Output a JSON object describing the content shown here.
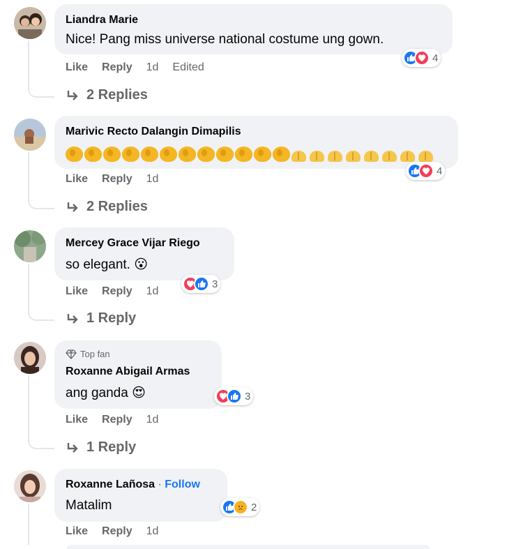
{
  "comments": [
    {
      "author": "Liandra Marie",
      "text": "Nice! Pang miss universe national costume ung gown.",
      "actions": {
        "like": "Like",
        "reply": "Reply",
        "time": "1d",
        "edited": "Edited"
      },
      "reactions": {
        "types": [
          "like",
          "love"
        ],
        "count": "4"
      },
      "replies_label": "2 Replies"
    },
    {
      "author": "Marivic Recto Dalangin Dimapilis",
      "text_emojis": {
        "clapping_hands": 12,
        "folded_hands": 8
      },
      "actions": {
        "like": "Like",
        "reply": "Reply",
        "time": "1d"
      },
      "reactions": {
        "types": [
          "like",
          "love"
        ],
        "count": "4"
      },
      "replies_label": "2 Replies"
    },
    {
      "author": "Mercey Grace Vijar Riego",
      "text": "so elegant. 😮",
      "actions": {
        "like": "Like",
        "reply": "Reply",
        "time": "1d"
      },
      "reactions": {
        "types": [
          "love",
          "like"
        ],
        "count": "3"
      },
      "replies_label": "1 Reply"
    },
    {
      "badge": "Top fan",
      "author": "Roxanne Abigail Armas",
      "text": "ang ganda 😍",
      "actions": {
        "like": "Like",
        "reply": "Reply",
        "time": "1d"
      },
      "reactions": {
        "types": [
          "love",
          "like"
        ],
        "count": "3"
      },
      "replies_label": "1 Reply"
    },
    {
      "author": "Roxanne Lañosa",
      "separator": " · ",
      "follow": "Follow",
      "text": "Matalim",
      "actions": {
        "like": "Like",
        "reply": "Reply",
        "time": "1d"
      },
      "reactions": {
        "types": [
          "like",
          "sad"
        ],
        "count": "2"
      }
    }
  ],
  "colors": {
    "bubble": "#f0f2f5",
    "like": "#1877f2",
    "love": "#f33e58",
    "sad": "#f7b125",
    "muted": "#65676b",
    "link": "#1877f2"
  }
}
